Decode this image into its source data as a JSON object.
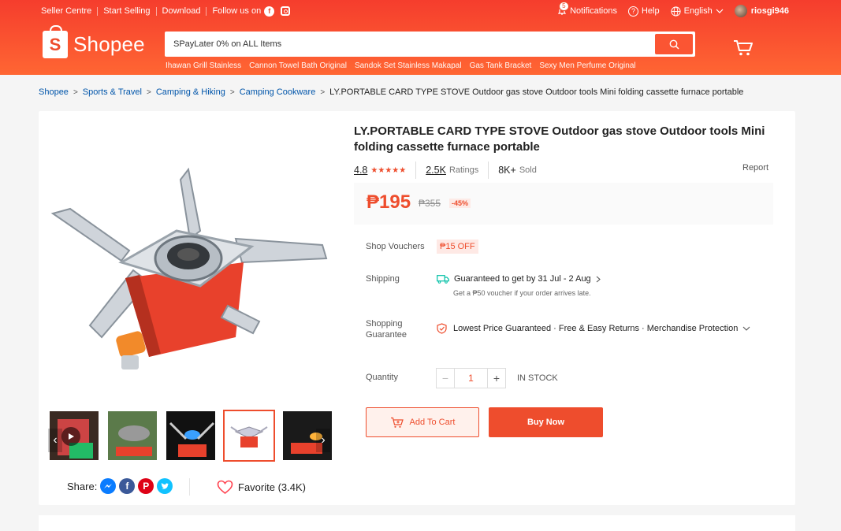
{
  "topbar": {
    "seller_centre": "Seller Centre",
    "start_selling": "Start Selling",
    "download": "Download",
    "follow_us": "Follow us on",
    "notifications_count": "5",
    "notifications": "Notifications",
    "help": "Help",
    "language": "English",
    "username": "riosgi946"
  },
  "logo": {
    "text": "Shopee",
    "bag_letter": "S"
  },
  "search": {
    "placeholder": "SPayLater 0% on ALL Items",
    "hints": [
      "Ihawan Grill Stainless",
      "Cannon Towel Bath Original",
      "Sandok Set Stainless Makapal",
      "Gas Tank Bracket",
      "Sexy Men Perfume Original"
    ]
  },
  "breadcrumb": {
    "items": [
      "Shopee",
      "Sports & Travel",
      "Camping & Hiking",
      "Camping Cookware"
    ],
    "current": "LY.PORTABLE CARD TYPE STOVE Outdoor gas stove Outdoor tools Mini folding cassette furnace portable"
  },
  "product": {
    "title": "LY.PORTABLE CARD TYPE STOVE Outdoor gas stove Outdoor tools Mini folding cassette furnace portable",
    "rating": "4.8",
    "stars": "★★★★★",
    "ratings_count": "2.5K",
    "ratings_label": "Ratings",
    "sold_count": "8K+",
    "sold_label": "Sold",
    "report": "Report",
    "price": "₱195",
    "old_price": "₱355",
    "discount": "-45%"
  },
  "details": {
    "vouchers_label": "Shop Vouchers",
    "voucher": "₱15 OFF",
    "shipping_label": "Shipping",
    "shipping_text": "Guaranteed to get by 31 Jul - 2 Aug",
    "shipping_sub": "Get a ₱50 voucher if your order arrives late.",
    "guarantee_label_1": "Shopping",
    "guarantee_label_2": "Guarantee",
    "guarantee_text": "Lowest Price Guaranteed · Free & Easy Returns · Merchandise Protection",
    "quantity_label": "Quantity",
    "quantity": "1",
    "minus": "−",
    "plus": "+",
    "stock": "IN STOCK"
  },
  "actions": {
    "add_to_cart": "Add To Cart",
    "buy_now": "Buy Now"
  },
  "social": {
    "share": "Share:",
    "favorite": "Favorite (3.4K)",
    "fb": "f",
    "pin": "P"
  },
  "colors": {
    "brand": "#ee4d2d",
    "link": "#0055aa"
  }
}
